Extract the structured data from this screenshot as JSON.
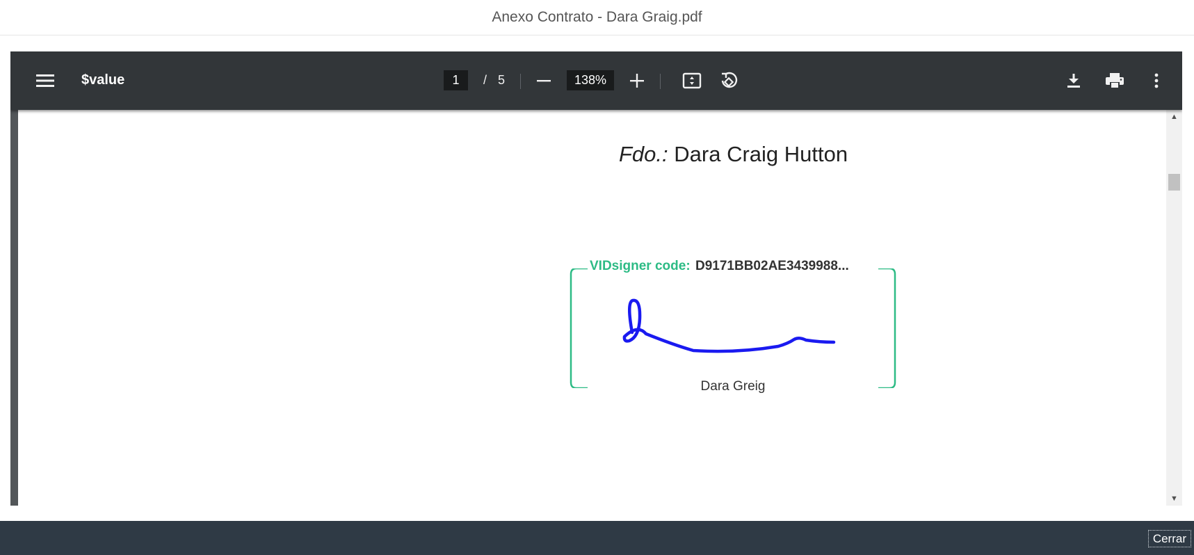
{
  "dialog": {
    "title": "Anexo Contrato - Dara Graig.pdf"
  },
  "toolbar": {
    "menu_icon": "hamburger-menu-icon",
    "document_title": "$value",
    "current_page": "1",
    "page_separator": "/",
    "total_pages": "5",
    "zoom_out_icon": "minus-icon",
    "zoom_level": "138%",
    "zoom_in_icon": "plus-icon",
    "fit_page_icon": "fit-to-page-icon",
    "rotate_icon": "rotate-counterclockwise-icon",
    "download_icon": "download-icon",
    "print_icon": "printer-icon",
    "more_icon": "more-vertical-icon"
  },
  "document": {
    "signed_by_prefix": "Fdo.:",
    "signed_by_name": " Dara Craig Hutton",
    "signature": {
      "label": "VIDsigner code:",
      "code": "D9171BB02AE3439988...",
      "signer_name": "Dara Greig",
      "box_color": "#2dbb85",
      "ink_color": "#1a1af0"
    }
  },
  "footer": {
    "close_label": "Cerrar"
  },
  "colors": {
    "toolbar_bg": "#323639",
    "viewer_bg": "#525659",
    "footer_bg": "#2f3a45"
  }
}
